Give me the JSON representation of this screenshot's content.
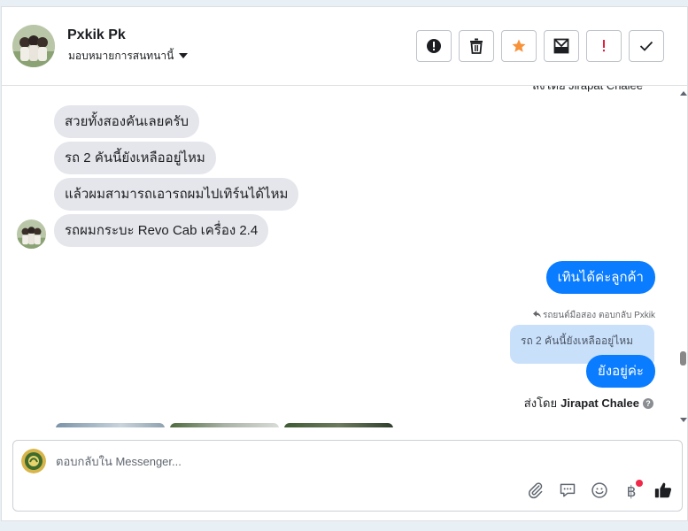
{
  "header": {
    "contact_name": "Pxkik Pk",
    "assign_label": "มอบหมายการสนทนานี้"
  },
  "toolbar": [
    {
      "name": "alert-button",
      "icon": "exclamation-circle-icon"
    },
    {
      "name": "delete-button",
      "icon": "trash-icon"
    },
    {
      "name": "star-button",
      "icon": "star-icon",
      "color": "#f7923a"
    },
    {
      "name": "archive-button",
      "icon": "mail-archive-icon"
    },
    {
      "name": "important-button",
      "icon": "exclamation-icon",
      "color": "#e41e3f"
    },
    {
      "name": "done-button",
      "icon": "checkmark-icon"
    }
  ],
  "conversation": {
    "clipped_top_text": "ส่งโดย Jirapat Chalee",
    "incoming": [
      "สวยทั้งสองคันเลยครับ",
      "รถ 2 คันนี้ยังเหลืออยู่ไหม",
      "แล้วผมสามารถเอารถผมไปเทิร์นได้ไหม",
      "รถผมกระบะ Revo Cab เครื่อง 2.4"
    ],
    "outgoing_1": "เทินได้ค่ะลูกค้า",
    "reply_meta": "รถยนต์มือสอง ตอบกลับ Pxkik",
    "quoted_text": "รถ 2 คันนี้ยังเหลืออยู่ไหม",
    "outgoing_2": "ยังอยู่ค่ะ",
    "sent_by_prefix": "ส่งโดย",
    "sent_by_name": "Jirapat Chalee"
  },
  "composer": {
    "placeholder": "ตอบกลับใน Messenger...",
    "icons": [
      "paperclip-icon",
      "saved-replies-icon",
      "emoji-icon",
      "payment-icon",
      "like-icon"
    ]
  },
  "colors": {
    "outgoing_bubble": "#0a7cff",
    "incoming_bubble": "#e4e6eb",
    "quoted_bubble": "#c9e0fb",
    "notification_dot": "#f02849"
  }
}
